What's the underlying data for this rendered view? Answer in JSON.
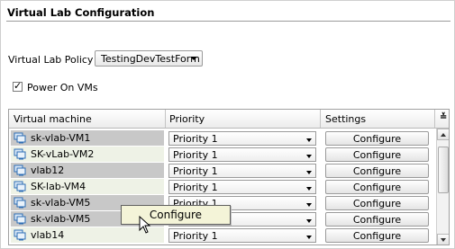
{
  "section": {
    "title": "Virtual Lab Configuration"
  },
  "policy": {
    "label": "Virtual Lab Policy",
    "selected": "TestingDevTestForm"
  },
  "power_on": {
    "label": "Power On VMs",
    "checked": true
  },
  "grid": {
    "columns": [
      "Virtual machine",
      "Priority",
      "Settings"
    ],
    "column_menu_icon": "double-chevron-down-icon",
    "rows": [
      {
        "vm": "sk-vlab-VM1",
        "priority": "Priority 1",
        "settings": "Configure",
        "selected": true
      },
      {
        "vm": "SK-vLab-VM2",
        "priority": "Priority 1",
        "settings": "Configure",
        "selected": false
      },
      {
        "vm": "vlab12",
        "priority": "Priority 1",
        "settings": "Configure",
        "selected": true
      },
      {
        "vm": "SK-lab-VM4",
        "priority": "Priority 1",
        "settings": "Configure",
        "selected": false
      },
      {
        "vm": "sk-vlab-VM5",
        "priority": "Priority 1",
        "settings": "Configure",
        "selected": true
      },
      {
        "vm": "sk-vlab-VM5",
        "priority": "Priority 1",
        "settings": "Configure",
        "selected": true
      },
      {
        "vm": "vlab14",
        "priority": "Priority 1",
        "settings": "Configure",
        "selected": false
      }
    ]
  },
  "drag": {
    "label": "Configure"
  },
  "colors": {
    "selected_row": "#c8c8c8",
    "alt_row": "#eef2e6",
    "drag_bg": "#f4f4d8"
  }
}
